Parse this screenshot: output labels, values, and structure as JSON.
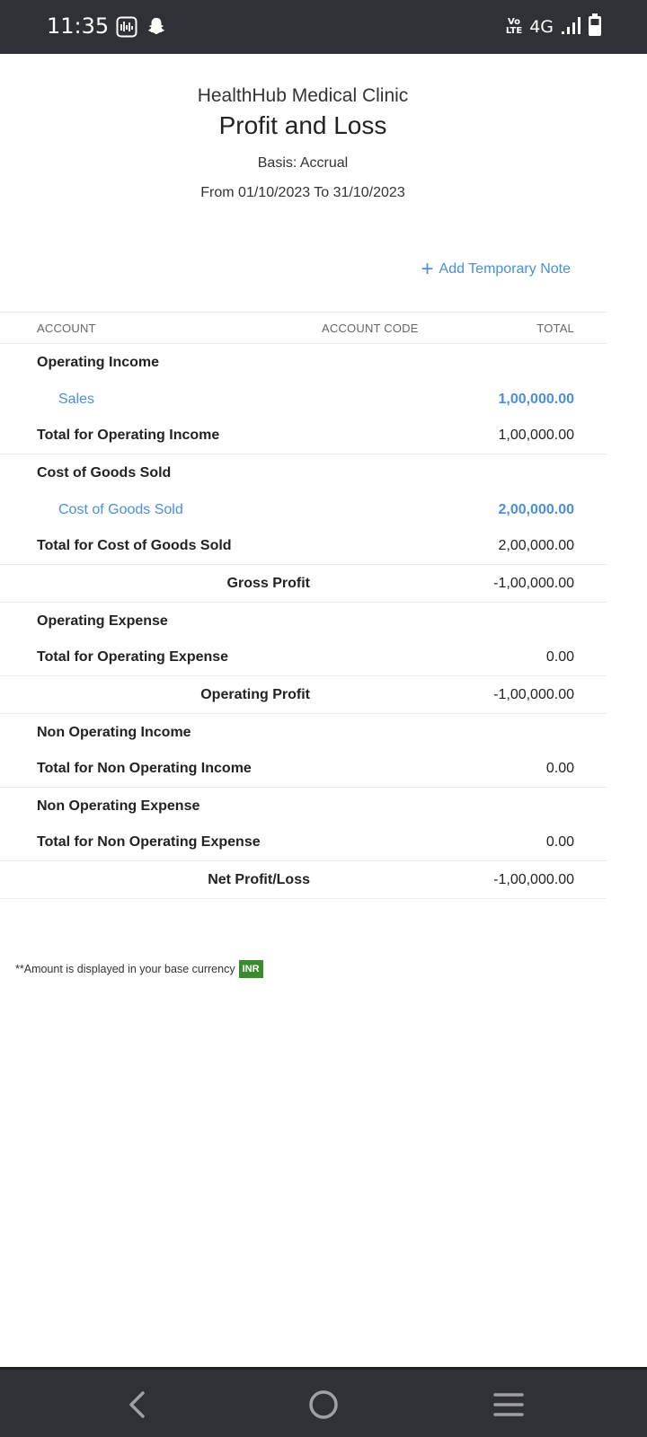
{
  "status_bar": {
    "time": "11:35",
    "left_icons": [
      "activity-icon",
      "snapchat-icon"
    ],
    "volte_label": [
      "Vo",
      "LTE"
    ],
    "network": "4G",
    "signal": "signal-icon",
    "battery": "battery-icon"
  },
  "report": {
    "organization": "HealthHub Medical Clinic",
    "title": "Profit and Loss",
    "basis": "Basis: Accrual",
    "period": "From 01/10/2023 To 31/10/2023",
    "add_note_label": "Add Temporary Note",
    "columns": {
      "account": "ACCOUNT",
      "account_code": "ACCOUNT CODE",
      "total": "TOTAL"
    },
    "rows": {
      "operating_income": "Operating Income",
      "sales": {
        "label": "Sales",
        "amount": "1,00,000.00"
      },
      "total_operating_income": {
        "label": "Total for Operating Income",
        "amount": "1,00,000.00"
      },
      "cogs": "Cost of Goods Sold",
      "cogs_account": {
        "label": "Cost of Goods Sold",
        "amount": "2,00,000.00"
      },
      "total_cogs": {
        "label": "Total for Cost of Goods Sold",
        "amount": "2,00,000.00"
      },
      "gross_profit": {
        "label": "Gross Profit",
        "amount": "-1,00,000.00"
      },
      "operating_expense": "Operating Expense",
      "total_operating_expense": {
        "label": "Total for Operating Expense",
        "amount": "0.00"
      },
      "operating_profit": {
        "label": "Operating Profit",
        "amount": "-1,00,000.00"
      },
      "non_operating_income": "Non Operating Income",
      "total_non_operating_income": {
        "label": "Total for Non Operating Income",
        "amount": "0.00"
      },
      "non_operating_expense": "Non Operating Expense",
      "total_non_operating_expense": {
        "label": "Total for Non Operating Expense",
        "amount": "0.00"
      },
      "net_profit": {
        "label": "Net Profit/Loss",
        "amount": "-1,00,000.00"
      }
    },
    "footnote": "**Amount is displayed in your base currency",
    "currency": "INR"
  },
  "nav_bar": {
    "buttons": [
      "back-icon",
      "home-icon",
      "menu-icon"
    ]
  },
  "colors": {
    "link": "#4a8fdb",
    "bar": "#303136",
    "badge": "#3a8a2e"
  }
}
